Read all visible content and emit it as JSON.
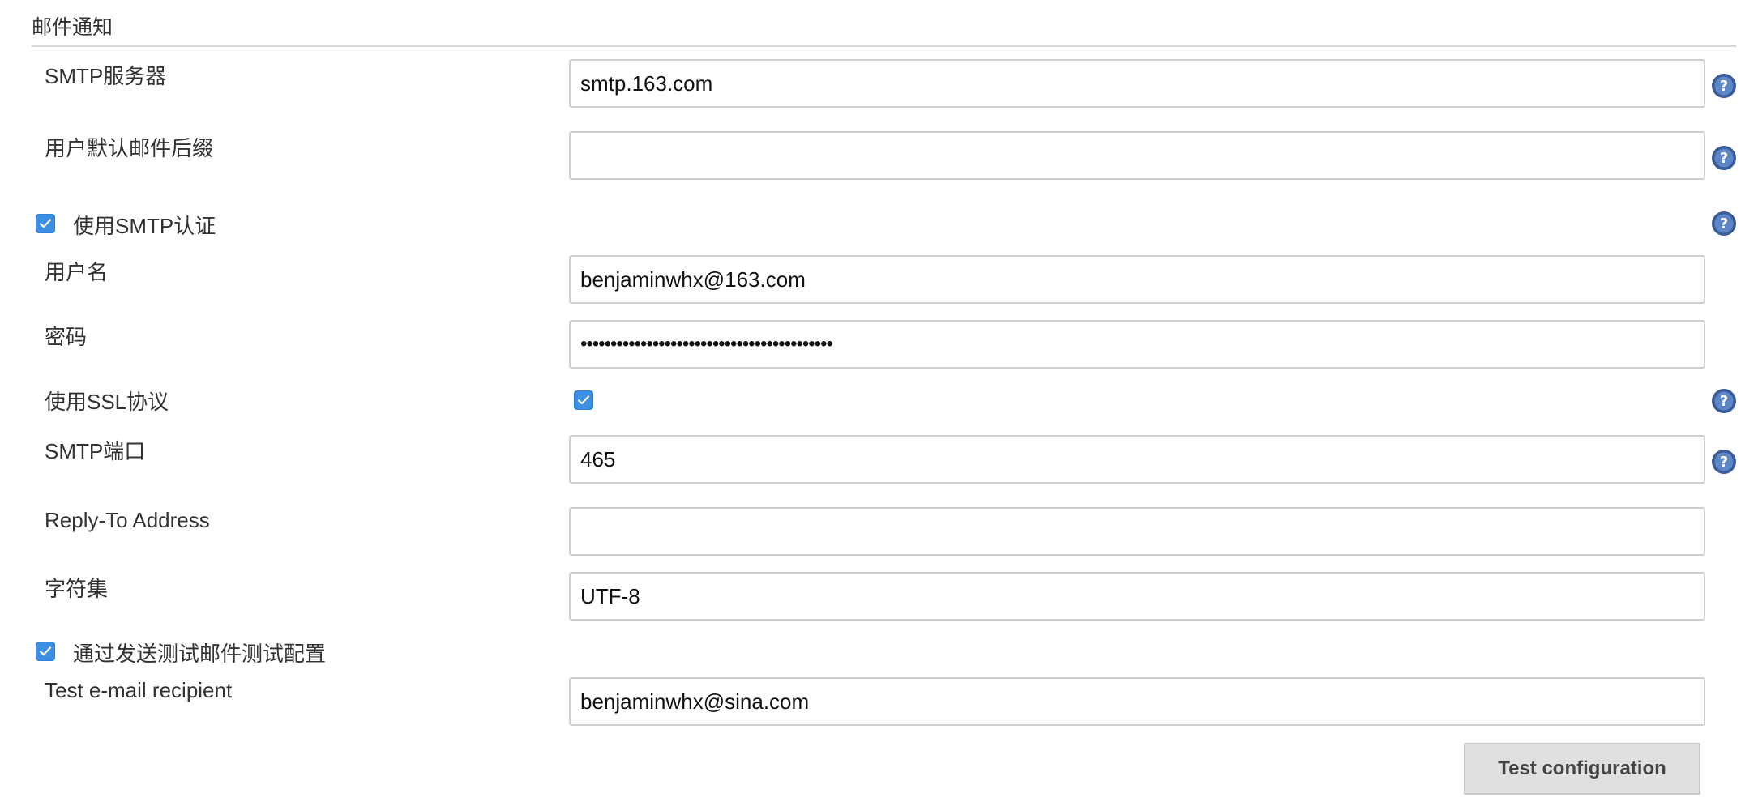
{
  "section": {
    "title": "邮件通知"
  },
  "fields": {
    "smtp_server": {
      "label": "SMTP服务器",
      "value": "smtp.163.com"
    },
    "default_suffix": {
      "label": "用户默认邮件后缀",
      "value": ""
    },
    "use_smtp_auth": {
      "label": "使用SMTP认证",
      "checked": true
    },
    "username": {
      "label": "用户名",
      "value": "benjaminwhx@163.com"
    },
    "password": {
      "label": "密码",
      "value": "••••••••••••••••••••••••••••••••••••••••••"
    },
    "use_ssl": {
      "label": "使用SSL协议",
      "checked": true
    },
    "smtp_port": {
      "label": "SMTP端口",
      "value": "465"
    },
    "reply_to": {
      "label": "Reply-To Address",
      "value": ""
    },
    "charset": {
      "label": "字符集",
      "value": "UTF-8"
    },
    "test_via_email": {
      "label": "通过发送测试邮件测试配置",
      "checked": true
    },
    "test_recipient": {
      "label": "Test e-mail recipient",
      "value": "benjaminwhx@sina.com"
    }
  },
  "buttons": {
    "test_configuration": "Test configuration"
  },
  "icons": {
    "help": "help-icon",
    "check": "checkmark-icon"
  },
  "colors": {
    "checkbox": "#3d8fe4",
    "help_icon": "#3a5c9b",
    "button_bg": "#e0e0e0"
  }
}
